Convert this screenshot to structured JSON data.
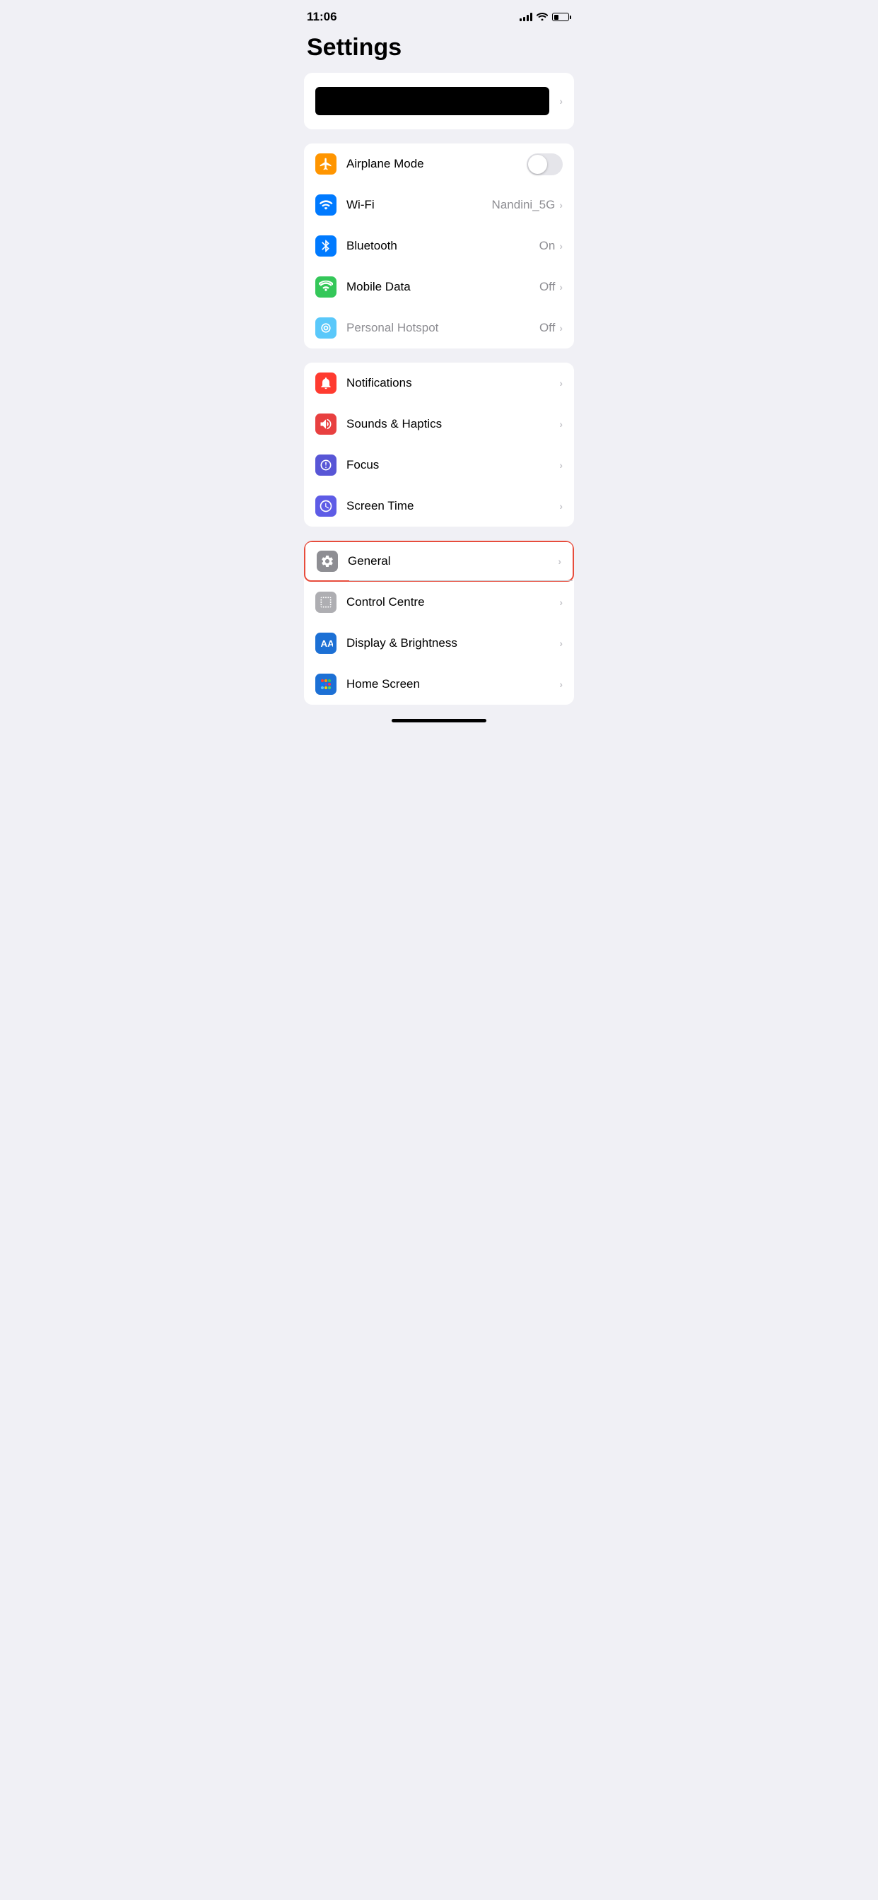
{
  "status_bar": {
    "time": "11:06",
    "signal_bars": 4,
    "wifi": true,
    "battery_percent": 35
  },
  "page_title": "Settings",
  "profile_row": {
    "chevron": "›"
  },
  "connectivity_section": {
    "items": [
      {
        "id": "airplane-mode",
        "label": "Airplane Mode",
        "value": "",
        "toggle": true,
        "toggle_on": false,
        "icon_color": "orange",
        "chevron": false
      },
      {
        "id": "wifi",
        "label": "Wi-Fi",
        "value": "Nandini_5G",
        "toggle": false,
        "icon_color": "blue",
        "chevron": "›"
      },
      {
        "id": "bluetooth",
        "label": "Bluetooth",
        "value": "On",
        "toggle": false,
        "icon_color": "blue",
        "chevron": "›"
      },
      {
        "id": "mobile-data",
        "label": "Mobile Data",
        "value": "Off",
        "toggle": false,
        "icon_color": "green",
        "chevron": "›"
      },
      {
        "id": "personal-hotspot",
        "label": "Personal Hotspot",
        "value": "Off",
        "toggle": false,
        "icon_color": "green-light",
        "disabled": true,
        "chevron": "›"
      }
    ]
  },
  "notifications_section": {
    "items": [
      {
        "id": "notifications",
        "label": "Notifications",
        "value": "",
        "icon_color": "red",
        "chevron": "›"
      },
      {
        "id": "sounds-haptics",
        "label": "Sounds & Haptics",
        "value": "",
        "icon_color": "red-medium",
        "chevron": "›"
      },
      {
        "id": "focus",
        "label": "Focus",
        "value": "",
        "icon_color": "purple",
        "chevron": "›"
      },
      {
        "id": "screen-time",
        "label": "Screen Time",
        "value": "",
        "icon_color": "indigo",
        "chevron": "›"
      }
    ]
  },
  "display_section": {
    "items": [
      {
        "id": "general",
        "label": "General",
        "value": "",
        "icon_color": "gray",
        "chevron": "›",
        "highlighted": true
      },
      {
        "id": "control-centre",
        "label": "Control Centre",
        "value": "",
        "icon_color": "gray2",
        "chevron": "›"
      },
      {
        "id": "display-brightness",
        "label": "Display & Brightness",
        "value": "",
        "icon_color": "blue-aa",
        "chevron": "›"
      },
      {
        "id": "home-screen",
        "label": "Home Screen",
        "value": "",
        "icon_color": "blue-home",
        "chevron": "›"
      }
    ]
  },
  "chevron_char": "›"
}
